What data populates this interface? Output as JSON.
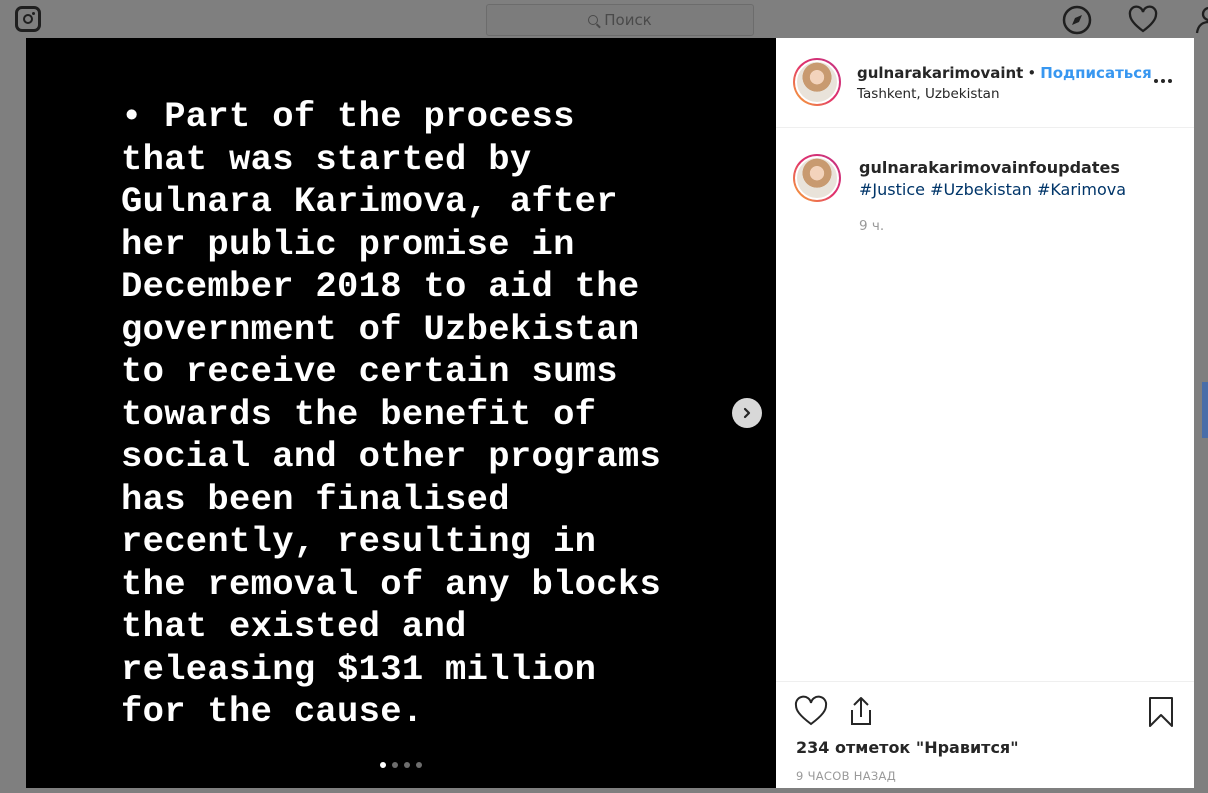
{
  "topbar": {
    "logo_icon": "instagram-logo-icon",
    "search_placeholder": "Поиск",
    "icons": [
      "explore-compass-icon",
      "activity-heart-icon",
      "profile-icon"
    ]
  },
  "post": {
    "media_text": "• Part of the process\nthat was started by\nGulnara Karimova, after\nher public promise in\nDecember 2018 to aid the\ngovernment of Uzbekistan\nto receive certain sums\ntowards the benefit of\nsocial and other programs\nhas been finalised\nrecently, resulting in\nthe removal of any blocks\nthat existed and\nreleasing $131 million\nfor the cause.",
    "carousel": {
      "total": 4,
      "active_index": 0
    },
    "header": {
      "username": "gulnarakarimovaint",
      "separator": "•",
      "follow_label": "Подписаться",
      "location": "Tashkent, Uzbekistan"
    },
    "caption": {
      "username": "gulnarakarimovainfoupdates",
      "tags": [
        "#Justice",
        "#Uzbekistan",
        "#Karimova"
      ],
      "time": "9 ч."
    },
    "likes_text": "234 отметок \"Нравится\"",
    "date_text": "9 ЧАСОВ НАЗАД"
  },
  "colors": {
    "link_blue": "#3897f0",
    "hashtag": "#003569",
    "overlay": "#7f7f7f"
  }
}
